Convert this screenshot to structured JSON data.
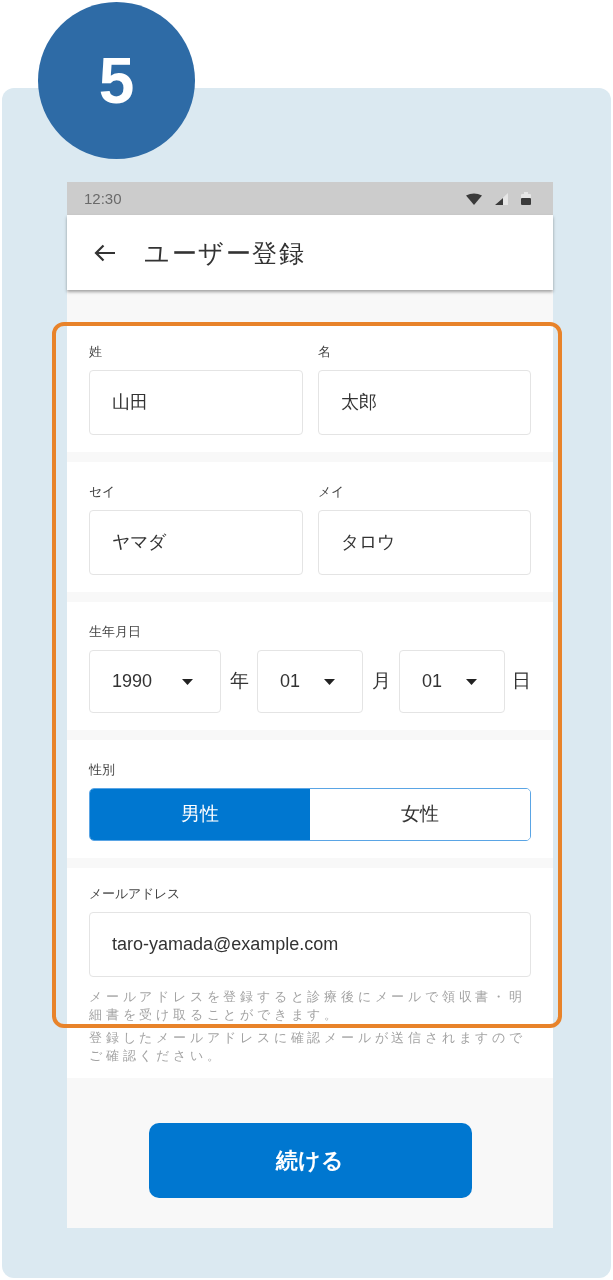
{
  "step_badge": {
    "number": "5"
  },
  "status_bar": {
    "time": "12:30"
  },
  "app_bar": {
    "title": "ユーザー登録"
  },
  "sections": [
    {
      "kind": "pair",
      "fields": [
        {
          "label": "姓",
          "value": "山田"
        },
        {
          "label": "名",
          "value": "太郎"
        }
      ]
    },
    {
      "kind": "pair",
      "fields": [
        {
          "label": "セイ",
          "value": "ヤマダ"
        },
        {
          "label": "メイ",
          "value": "タロウ"
        }
      ]
    },
    {
      "kind": "date",
      "label": "生年月日",
      "parts": [
        {
          "value": "1990",
          "unit": "年"
        },
        {
          "value": "01",
          "unit": "月"
        },
        {
          "value": "01",
          "unit": "日"
        }
      ]
    },
    {
      "kind": "toggle",
      "label": "性別",
      "options": [
        {
          "label": "男性",
          "selected": true
        },
        {
          "label": "女性",
          "selected": false
        }
      ]
    },
    {
      "kind": "email",
      "label": "メールアドレス",
      "value": "taro-yamada@example.com",
      "notes": [
        "メールアドレスを登録すると診療後にメールで領収書・明細書を受け取ることができます。",
        "登録したメールアドレスに確認メールが送信されますのでご確認ください。"
      ]
    }
  ],
  "continue_button": {
    "label": "続ける"
  }
}
